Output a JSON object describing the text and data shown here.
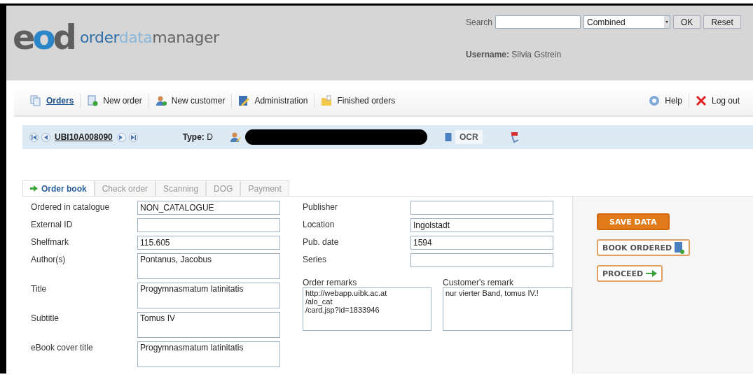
{
  "logo": {
    "mark": "eod",
    "name_parts": [
      "order",
      "data",
      "manager"
    ]
  },
  "search": {
    "label": "Search",
    "mode": "Combined",
    "buttons": [
      "OK",
      "Reset"
    ]
  },
  "username": "**Username:** Silvia Gstrein",
  "nav": {
    "left": [
      {
        "label": "Orders",
        "selected": true
      },
      {
        "label": "New order",
        "selected": false
      },
      {
        "label": "New customer",
        "selected": false
      },
      {
        "label": "Administration",
        "selected": false
      },
      {
        "label": "Finished orders",
        "selected": false
      }
    ],
    "right": [
      {
        "label": "Help"
      },
      {
        "label": "Log out"
      }
    ]
  },
  "record": {
    "id": "UBI10A008090",
    "type_label": "Type:",
    "type_value": "D",
    "ocr": "OCR"
  },
  "tabs": [
    {
      "label": "Order book",
      "selected": true
    },
    {
      "label": "Check order",
      "selected": false
    },
    {
      "label": "Scanning",
      "selected": false
    },
    {
      "label": "DOG",
      "selected": false
    },
    {
      "label": "Payment",
      "selected": false
    }
  ],
  "left_fields": [
    {
      "label": "Ordered in catalogue",
      "value": "NON_CATALOGUE",
      "kind": "line"
    },
    {
      "label": "External ID",
      "kind": "line"
    },
    {
      "label": "Shelfmark",
      "value": "115.605",
      "kind": "line"
    },
    {
      "label": "Author(s)",
      "value": "Pontanus, Jacobus",
      "kind": "area"
    },
    {
      "label": "Title",
      "value": "Progymnasmatum latinitatis",
      "kind": "area"
    },
    {
      "label": "Subtitle",
      "value": "Tomus IV",
      "kind": "area"
    },
    {
      "label": "eBook cover title",
      "value": "Progymnasmatum latinitatis",
      "kind": "area"
    }
  ],
  "right_fields": [
    {
      "label": "Publisher"
    },
    {
      "label": "Location",
      "value": "Ingolstadt"
    },
    {
      "label": "Pub. date",
      "value": "1594"
    },
    {
      "label": "Series"
    }
  ],
  "remarks": [
    {
      "label": "Order remarks",
      "value": "http://webapp.uibk.ac.at\n/alo_cat\n/card.jsp?id=1833946"
    },
    {
      "label": "Customer's remark",
      "value": "nur vierter Band, tomus IV.!"
    }
  ],
  "actions": [
    {
      "label": "SAVE DATA",
      "kind": "primary"
    },
    {
      "label": "BOOK ORDERED",
      "kind": "book"
    },
    {
      "label": "PROCEED",
      "kind": "proceed"
    }
  ]
}
